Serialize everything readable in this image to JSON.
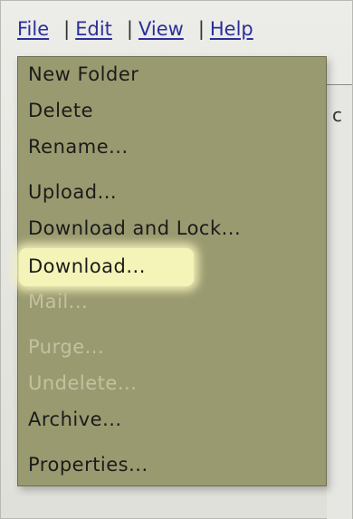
{
  "menubar": {
    "file": "File",
    "sep1": "|",
    "edit": "Edit",
    "sep2": "|",
    "view": "View",
    "sep3": "|",
    "help": "Help"
  },
  "background": {
    "partial_letter": "c"
  },
  "file_menu": {
    "items": [
      {
        "label": "New Folder",
        "enabled": true
      },
      {
        "label": "Delete",
        "enabled": true
      },
      {
        "label": "Rename...",
        "enabled": true
      },
      {
        "label": "Upload...",
        "enabled": true
      },
      {
        "label": "Download and Lock...",
        "enabled": true
      },
      {
        "label": "Download...",
        "enabled": true,
        "highlighted": true
      },
      {
        "label": "Mail...",
        "enabled": false
      },
      {
        "label": "Purge...",
        "enabled": false
      },
      {
        "label": "Undelete...",
        "enabled": false
      },
      {
        "label": "Archive...",
        "enabled": true
      },
      {
        "label": "Properties...",
        "enabled": true
      }
    ]
  },
  "colors": {
    "menu_background": "#9a9a70",
    "highlight": "#f4f3b8",
    "link": "#2a2f9a",
    "disabled_text": "#c2c2a0"
  }
}
